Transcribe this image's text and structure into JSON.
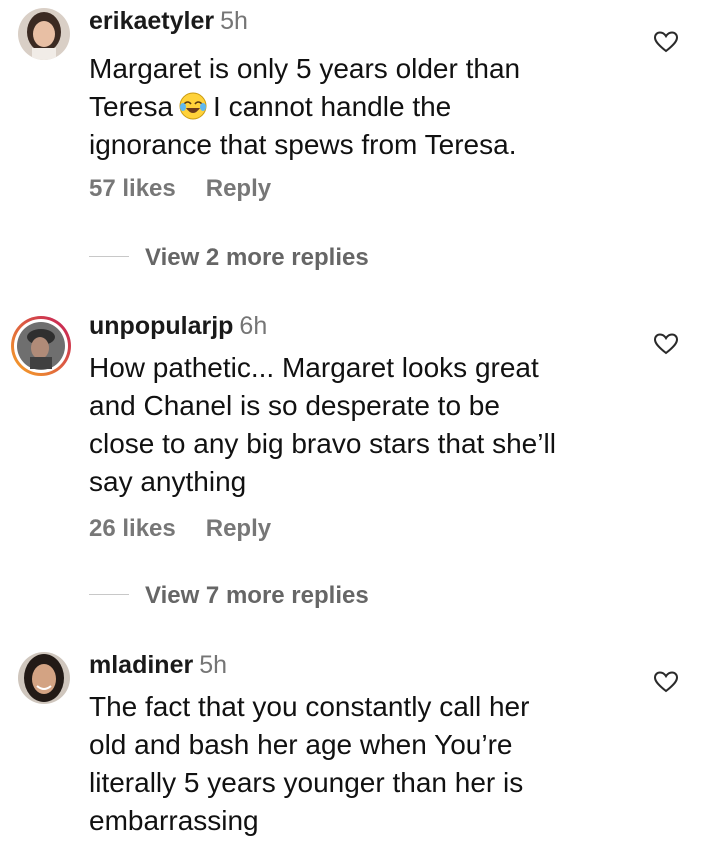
{
  "comments": [
    {
      "username": "erikaetyler",
      "time": "5h",
      "lines": [
        "Margaret is only 5 years older than",
        "Teresa",
        "I cannot handle the",
        "ignorance that spews from Teresa."
      ],
      "emoji": "face-with-tears-of-joy",
      "likes": "57 likes",
      "reply_label": "Reply",
      "view_replies": "View 2 more replies"
    },
    {
      "username": "unpopularjp",
      "time": "6h",
      "lines": [
        "How pathetic... Margaret looks great",
        "and Chanel is so desperate to be",
        "close to any big bravo stars that she’ll",
        "say anything"
      ],
      "likes": "26 likes",
      "reply_label": "Reply",
      "view_replies": "View 7 more replies"
    },
    {
      "username": "mladiner",
      "time": "5h",
      "lines": [
        "The fact that you constantly call her",
        "old and bash her age when You’re",
        "literally 5 years younger than her is",
        "embarrassing"
      ]
    }
  ],
  "icons": {
    "like": "heart-outline-icon"
  },
  "colors": {
    "text": "#111111",
    "muted": "#777777",
    "story_ring_start": "#f9a825",
    "story_ring_end": "#c2185b"
  }
}
